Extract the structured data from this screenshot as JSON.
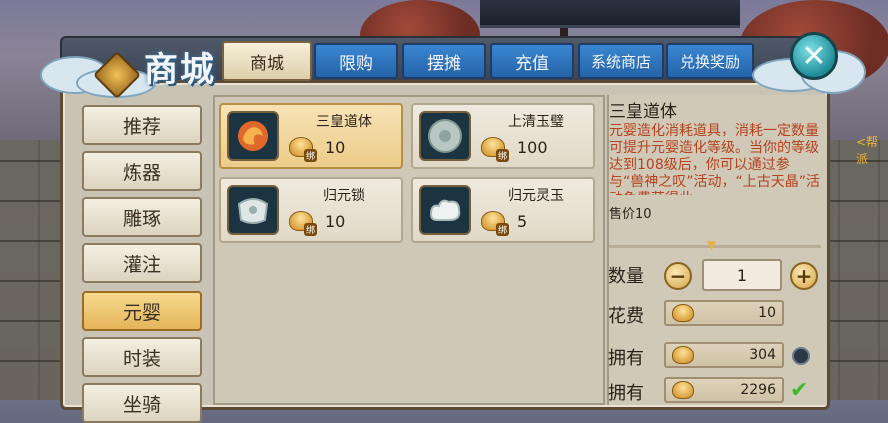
{
  "logo": {
    "title": "商城"
  },
  "tabs": [
    {
      "label": "商城",
      "active": true
    },
    {
      "label": "限购",
      "active": false
    },
    {
      "label": "摆摊",
      "active": false
    },
    {
      "label": "充值",
      "active": false
    },
    {
      "label": "系统商店",
      "active": false
    },
    {
      "label": "兑换奖励",
      "active": false
    }
  ],
  "close": {
    "icon": "close-icon"
  },
  "sidebar": {
    "items": [
      {
        "label": "推荐"
      },
      {
        "label": "炼器"
      },
      {
        "label": "雕琢"
      },
      {
        "label": "灌注"
      },
      {
        "label": "元婴",
        "active": true
      },
      {
        "label": "时装"
      },
      {
        "label": "坐骑"
      }
    ]
  },
  "items": [
    {
      "name": "三皇道体",
      "price": "10",
      "selected": true,
      "icon": "phoenix-orb-icon"
    },
    {
      "name": "上清玉璧",
      "price": "100",
      "icon": "jade-disc-icon"
    },
    {
      "name": "归元锁",
      "price": "10",
      "icon": "jade-lock-icon"
    },
    {
      "name": "归元灵玉",
      "price": "5",
      "icon": "cloud-jade-icon"
    }
  ],
  "detail": {
    "title": "三皇道体",
    "description": "元婴造化消耗道具，消耗一定数量可提升元婴造化等级。当你的等级达到108级后，你可以通过参与“兽神之叹”活动，“上古天晶”活动免费获得此",
    "sale_label": "售价10",
    "quantity_label": "数量",
    "quantity_value": "1",
    "cost_label": "花费",
    "cost_value": "10",
    "own_label": "拥有",
    "own_value": "304",
    "own2_label": "拥有",
    "own2_value": "2296"
  },
  "currency_badge": "绑",
  "side_text": "<帮派"
}
